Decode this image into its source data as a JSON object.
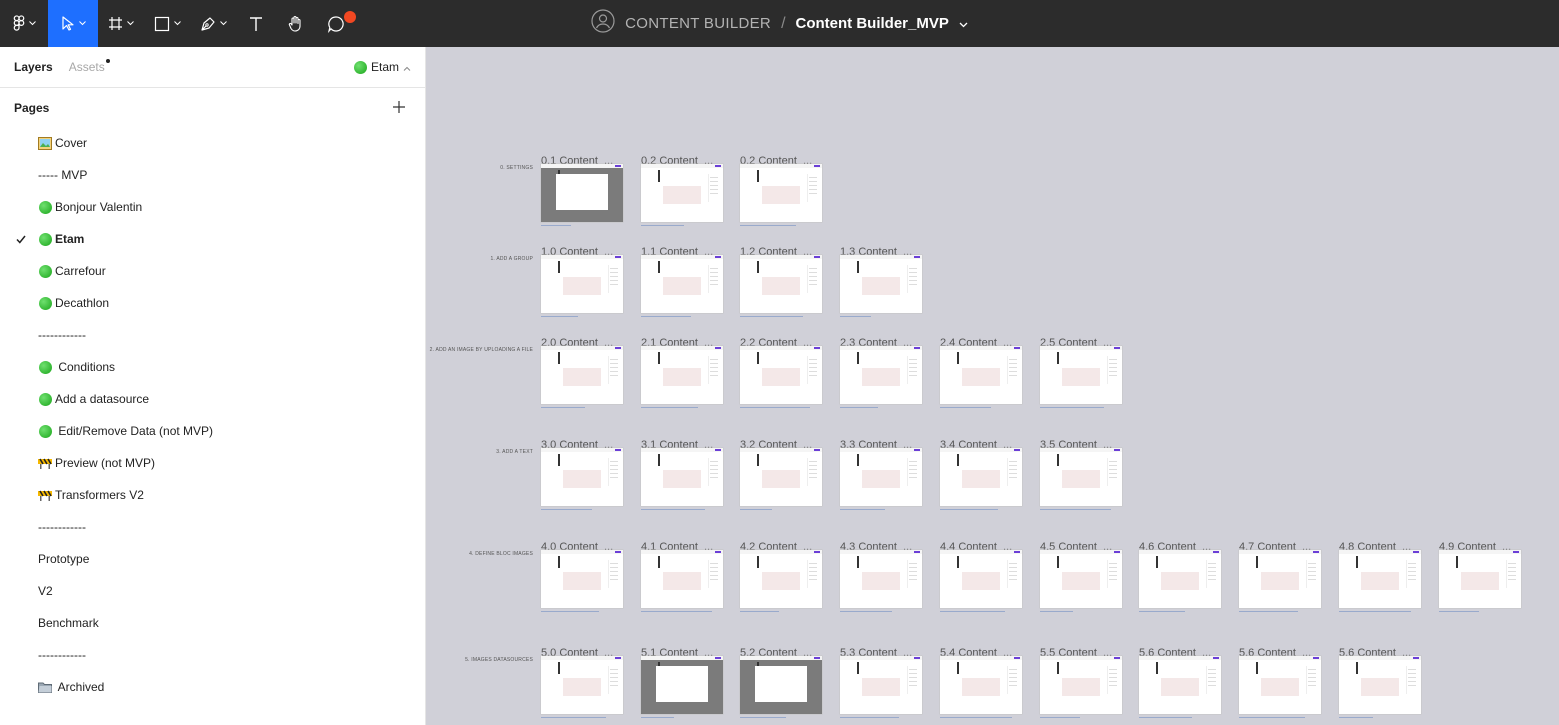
{
  "toolbar": {
    "tools": [
      {
        "name": "main-menu",
        "icon": "figma-logo-icon"
      },
      {
        "name": "move-tool",
        "icon": "cursor-arrow-icon",
        "active": true
      },
      {
        "name": "frame-tool",
        "icon": "frame-hash-icon"
      },
      {
        "name": "shape-tool",
        "icon": "rectangle-icon"
      },
      {
        "name": "pen-tool",
        "icon": "pen-icon"
      },
      {
        "name": "text-tool",
        "icon": "text-T-icon"
      },
      {
        "name": "hand-tool",
        "icon": "hand-icon"
      },
      {
        "name": "comment-tool",
        "icon": "comment-bubble-icon"
      }
    ],
    "team": "CONTENT BUILDER",
    "separator": "/",
    "file_name": "Content Builder_MVP"
  },
  "sidebar": {
    "tab_layers": "Layers",
    "tab_assets": "Assets",
    "current_page": "Etam",
    "pages_title": "Pages",
    "pages": [
      {
        "label": "Cover",
        "icon": "picture-emoji"
      },
      {
        "label": "----- MVP",
        "icon": ""
      },
      {
        "label": "Bonjour Valentin",
        "icon": "green-circle"
      },
      {
        "label": "Etam",
        "icon": "green-circle",
        "selected": true
      },
      {
        "label": "Carrefour",
        "icon": "green-circle"
      },
      {
        "label": "Decathlon",
        "icon": "green-circle"
      },
      {
        "label": "------------",
        "icon": ""
      },
      {
        "label": " Conditions",
        "icon": "green-circle"
      },
      {
        "label": "Add a datasource",
        "icon": "green-circle"
      },
      {
        "label": " Edit/Remove Data (not MVP)",
        "icon": "green-circle"
      },
      {
        "label": "Preview (not MVP)",
        "icon": "construction-emoji"
      },
      {
        "label": "Transformers V2",
        "icon": "construction-emoji"
      },
      {
        "label": "------------",
        "icon": ""
      },
      {
        "label": "Prototype",
        "icon": ""
      },
      {
        "label": "V2",
        "icon": ""
      },
      {
        "label": "Benchmark",
        "icon": ""
      },
      {
        "label": "------------",
        "icon": ""
      },
      {
        "label": " Archived",
        "icon": "folder-emoji"
      }
    ]
  },
  "canvas": {
    "rows": [
      {
        "label": "0. SETTINGS",
        "frames": [
          "0.1 Content_...",
          "0.2 Content_...",
          "0.2 Content_..."
        ],
        "dark": [
          0
        ]
      },
      {
        "label": "1. ADD A GROUP",
        "frames": [
          "1.0 Content_...",
          "1.1 Content_...",
          "1.2 Content_...",
          "1.3 Content_..."
        ],
        "dark": []
      },
      {
        "label": "2. ADD AN IMAGE BY UPLOADING A FILE",
        "frames": [
          "2.0 Content_...",
          "2.1 Content_...",
          "2.2 Content_...",
          "2.3 Content_...",
          "2.4 Content_...",
          "2.5 Content_..."
        ],
        "dark": []
      },
      {
        "label": "3. ADD A TEXT",
        "frames": [
          "3.0 Content_...",
          "3.1 Content_...",
          "3.2 Content_...",
          "3.3 Content_...",
          "3.4 Content_...",
          "3.5 Content_..."
        ],
        "dark": []
      },
      {
        "label": "4. DEFINE BLOC IMAGES",
        "frames": [
          "4.0 Content_...",
          "4.1 Content_...",
          "4.2 Content_...",
          "4.3 Content_...",
          "4.4 Content_...",
          "4.5 Content_...",
          "4.6 Content_...",
          "4.7 Content_...",
          "4.8 Content_...",
          "4.9 Content_..."
        ],
        "dark": []
      },
      {
        "label": "5. IMAGES DATASOURCES",
        "frames": [
          "5.0 Content_...",
          "5.1 Content_...",
          "5.2 Content_...",
          "5.3 Content_...",
          "5.4 Content_...",
          "5.5 Content_...",
          "5.6 Content_...",
          "5.6 Content_...",
          "5.6 Content_..."
        ],
        "dark": [
          1,
          2
        ]
      }
    ]
  },
  "colors": {
    "toolbar_bg": "#2c2c2c",
    "active_tool": "#1e6fff",
    "canvas_bg": "#d0d0d8",
    "notification": "#f24822",
    "accent_purple": "#6b3fd6"
  }
}
